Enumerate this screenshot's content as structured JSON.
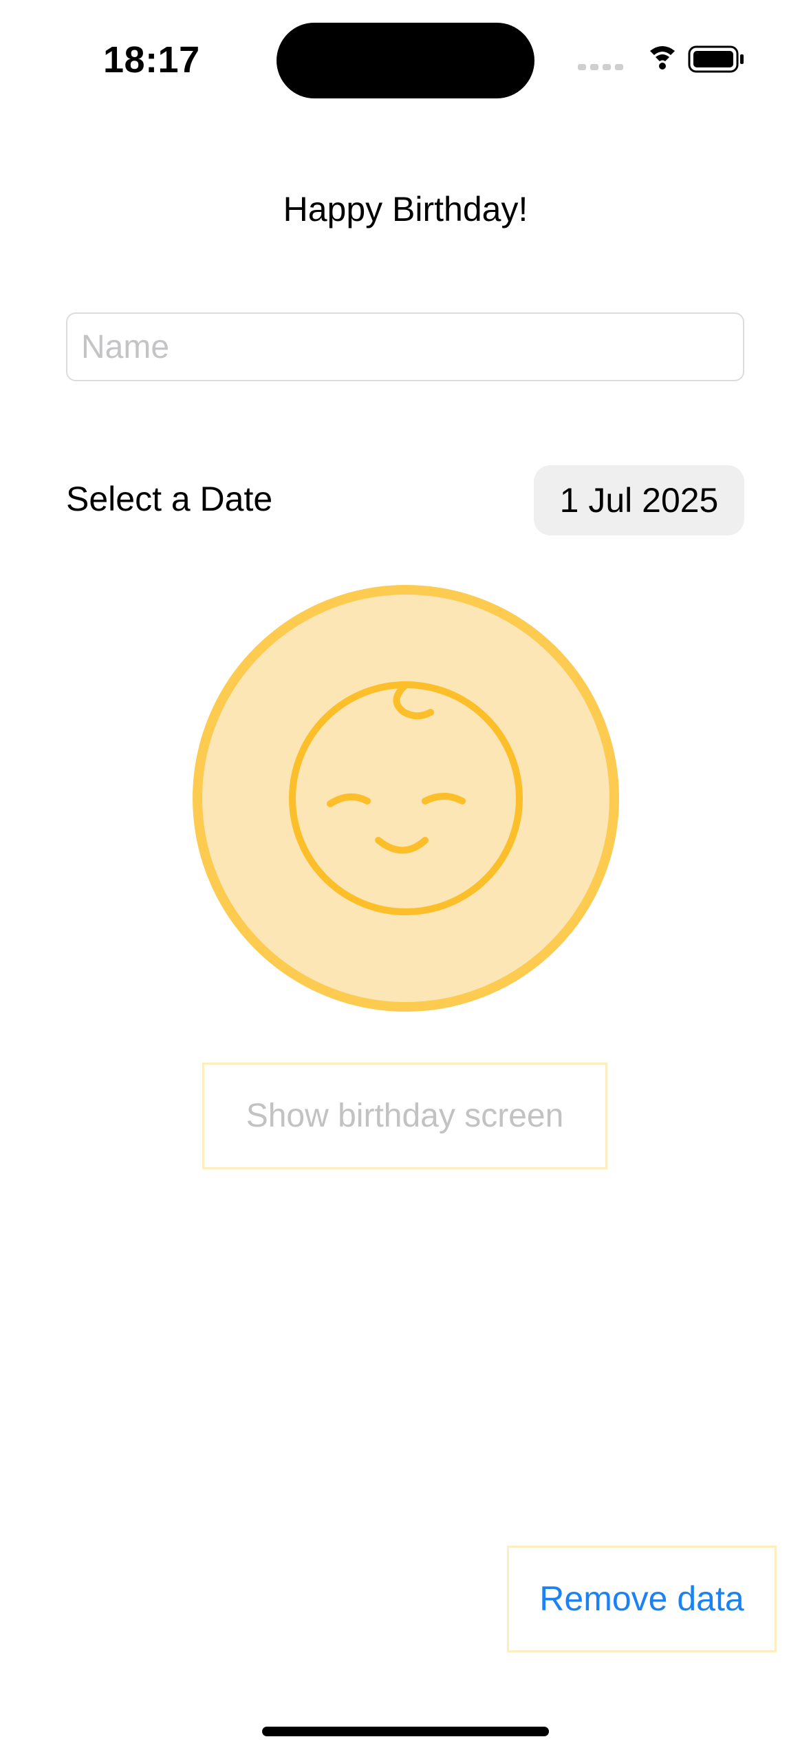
{
  "status_bar": {
    "time": "18:17",
    "icons": [
      "cellular-dots-icon",
      "wifi-icon",
      "battery-icon"
    ]
  },
  "screen": {
    "title": "Happy Birthday!"
  },
  "name_input": {
    "value": "",
    "placeholder": "Name"
  },
  "date_row": {
    "label": "Select a Date",
    "value": "1 Jul 2025"
  },
  "avatar": {
    "icon": "baby-face-icon"
  },
  "buttons": {
    "show_birthday": "Show birthday screen",
    "remove_data": "Remove data"
  },
  "colors": {
    "accent_blue": "#1a82f3",
    "avatar_fill": "#fce6b6",
    "avatar_ring": "#fccb4f",
    "face_stroke": "#fcbf2a",
    "button_border": "#fdeec0",
    "disabled_text": "#c2c2c2"
  }
}
